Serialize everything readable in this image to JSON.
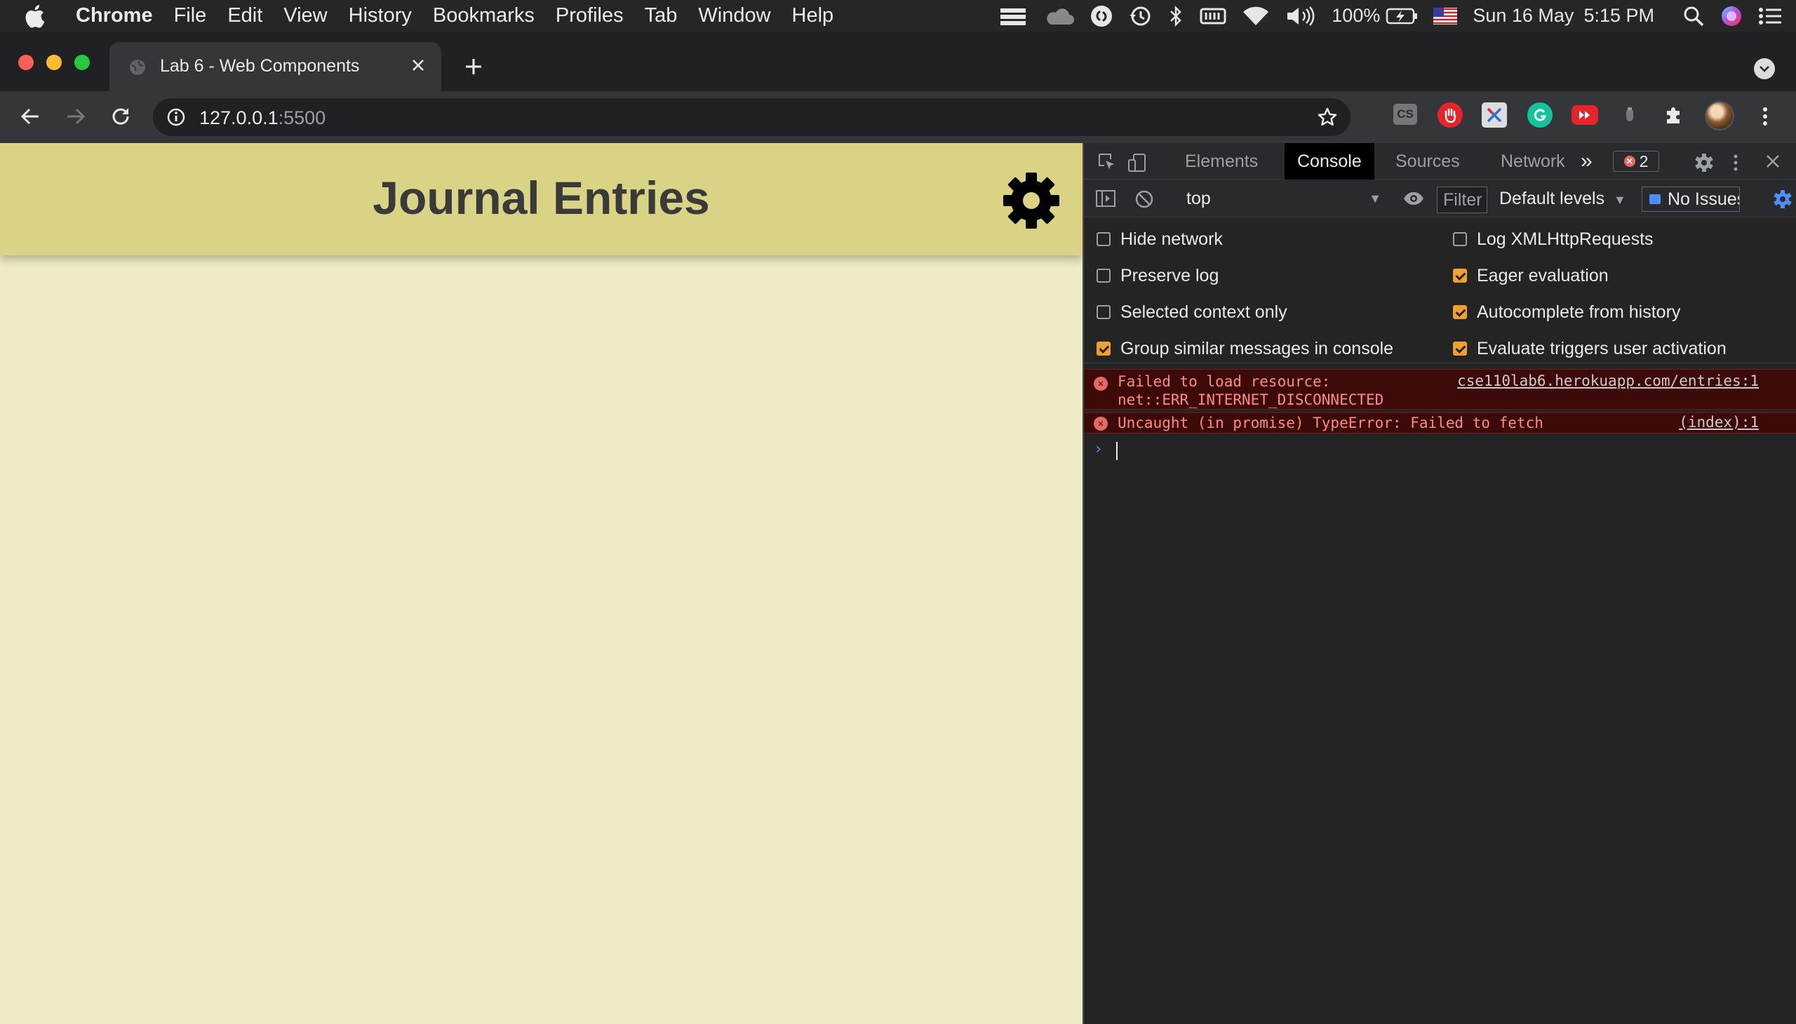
{
  "menubar": {
    "app": "Chrome",
    "items": [
      "File",
      "Edit",
      "View",
      "History",
      "Bookmarks",
      "Profiles",
      "Tab",
      "Window",
      "Help"
    ],
    "battery": "100%",
    "date": "Sun 16 May",
    "time": "5:15 PM"
  },
  "browser": {
    "tab_title": "Lab 6 - Web Components",
    "url_host": "127.0.0.1",
    "url_port": ":5500",
    "extensions": {
      "lastpass": "CS"
    }
  },
  "page": {
    "title": "Journal Entries"
  },
  "devtools": {
    "tabs": [
      "Elements",
      "Console",
      "Sources",
      "Network"
    ],
    "active_tab": "Console",
    "more_tabs": "»",
    "error_count": "2",
    "context": "top",
    "filter_placeholder": "Filter",
    "levels": "Default levels",
    "issues": "No Issues",
    "settings_left": [
      {
        "label": "Hide network",
        "checked": false
      },
      {
        "label": "Preserve log",
        "checked": false
      },
      {
        "label": "Selected context only",
        "checked": false
      },
      {
        "label": "Group similar messages in console",
        "checked": true
      }
    ],
    "settings_right": [
      {
        "label": "Log XMLHttpRequests",
        "checked": false
      },
      {
        "label": "Eager evaluation",
        "checked": true
      },
      {
        "label": "Autocomplete from history",
        "checked": true
      },
      {
        "label": "Evaluate triggers user activation",
        "checked": true
      }
    ],
    "messages": [
      {
        "text": "Failed to load resource:\nnet::ERR_INTERNET_DISCONNECTED",
        "source": "cse110lab6.herokuapp.com/entries:1"
      },
      {
        "text": "Uncaught (in promise) TypeError: Failed to fetch",
        "source": "(index):1"
      }
    ],
    "prompt": "›"
  },
  "colors": {
    "page_bg": "#efebc6",
    "header_bg": "#d9d385",
    "error_bg": "#3d0a0a",
    "error_text": "#ff8a80",
    "checkbox_on": "#f0a030"
  }
}
